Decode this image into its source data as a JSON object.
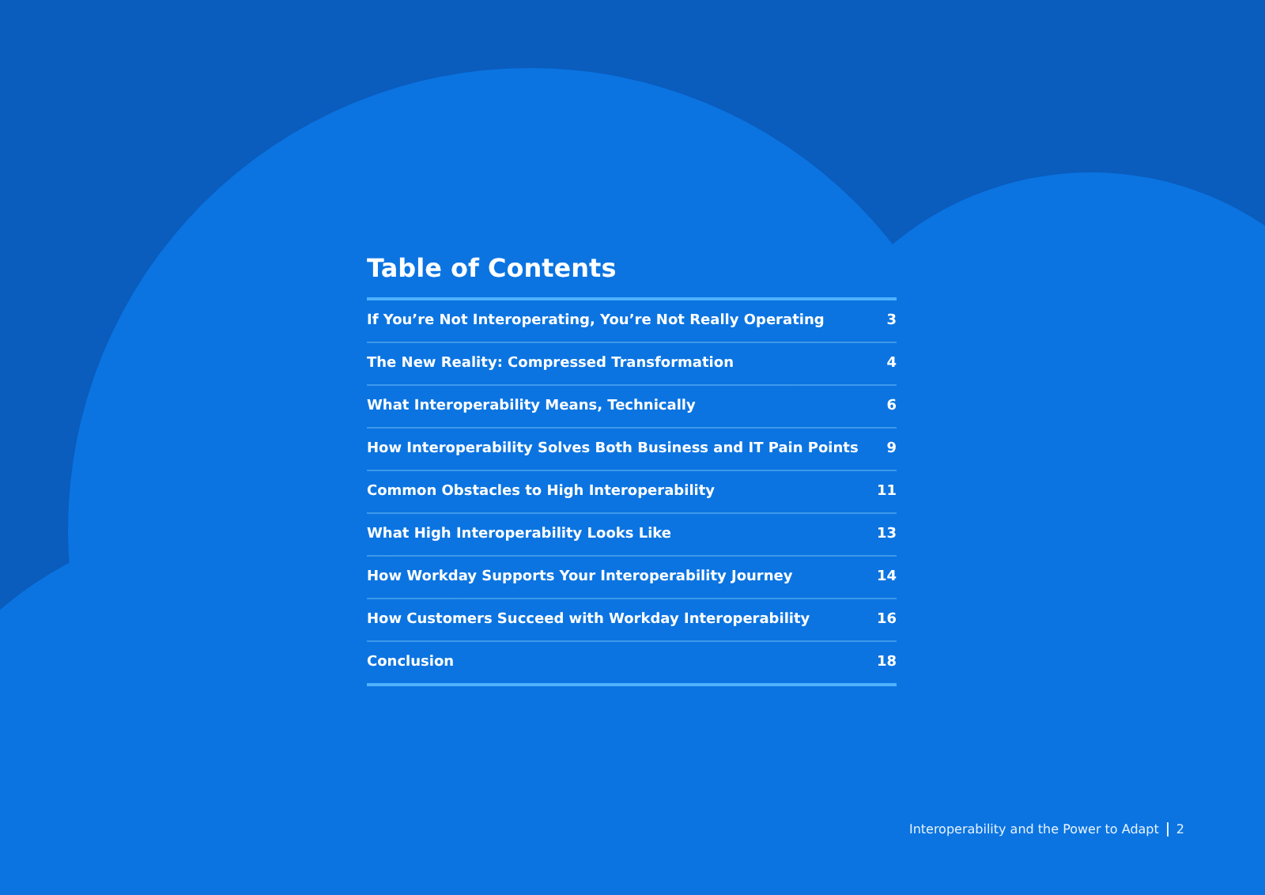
{
  "toc": {
    "title": "Table of Contents",
    "entries": [
      {
        "label": "If You’re Not Interoperating, You’re Not Really Operating",
        "page": "3"
      },
      {
        "label": "The New Reality: Compressed Transformation",
        "page": "4"
      },
      {
        "label": "What Interoperability Means, Technically",
        "page": "6"
      },
      {
        "label": "How Interoperability Solves Both Business and IT Pain Points",
        "page": "9"
      },
      {
        "label": "Common Obstacles to High Interoperability",
        "page": "11"
      },
      {
        "label": "What High Interoperability Looks Like",
        "page": "13"
      },
      {
        "label": "How Workday Supports Your Interoperability Journey",
        "page": "14"
      },
      {
        "label": "How Customers Succeed with Workday Interoperability",
        "page": "16"
      },
      {
        "label": "Conclusion",
        "page": "18"
      }
    ]
  },
  "footer": {
    "title": "Interoperability and the Power to Adapt",
    "page_number": "2"
  }
}
